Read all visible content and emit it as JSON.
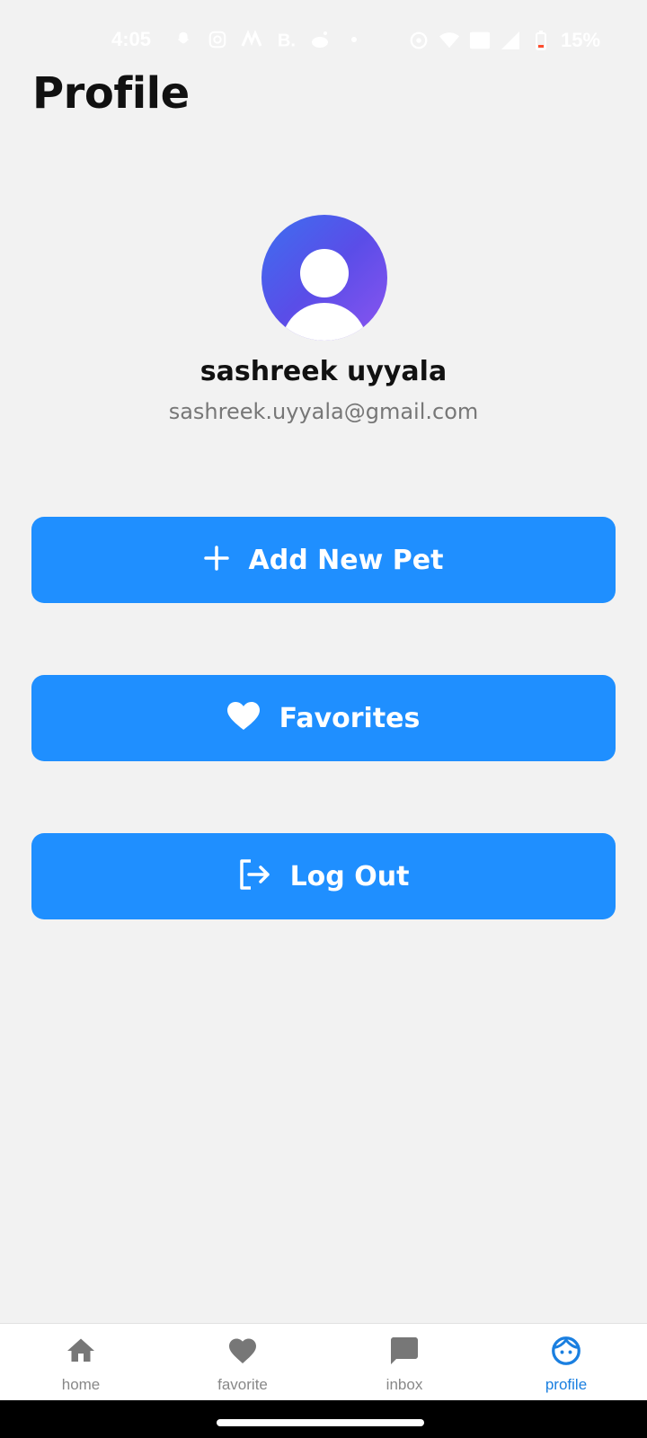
{
  "status_bar": {
    "time": "4:05",
    "battery": "15%",
    "icons_left": [
      "snapchat-icon",
      "instagram-icon",
      "paytm-icon",
      "booking-icon",
      "reddit-icon",
      "dot-icon"
    ],
    "icons_right": [
      "hotspot-icon",
      "wifi-icon",
      "volte-icon",
      "signal-icon",
      "battery-icon"
    ]
  },
  "page": {
    "title": "Profile"
  },
  "profile": {
    "name": "sashreek uyyala",
    "email": "sashreek.uyyala@gmail.com"
  },
  "actions": {
    "add_pet": "Add New Pet",
    "favorites": "Favorites",
    "logout": "Log Out"
  },
  "nav": {
    "home": "home",
    "favorite": "favorite",
    "inbox": "inbox",
    "profile": "profile",
    "active": "profile"
  },
  "colors": {
    "accent": "#1f8fff",
    "background": "#f2f2f2",
    "active_nav": "#1a7fe0"
  }
}
